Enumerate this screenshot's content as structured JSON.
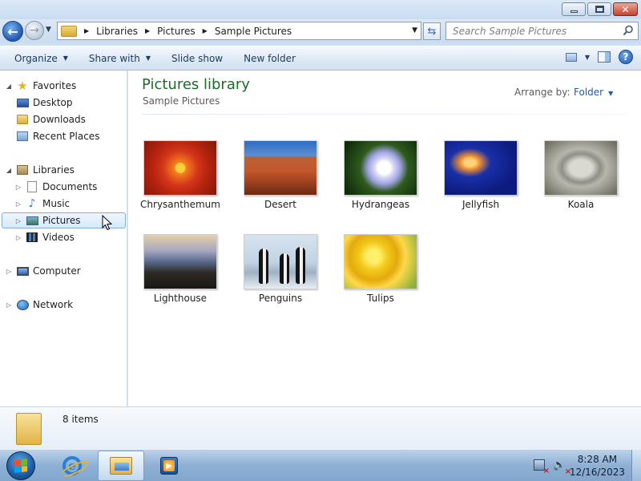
{
  "window": {
    "buttons": {
      "minimize_icon": "minimize-icon",
      "maximize_icon": "maximize-icon",
      "close_icon": "close-icon"
    }
  },
  "address_bar": {
    "breadcrumbs": [
      "Libraries",
      "Pictures",
      "Sample Pictures"
    ],
    "search_placeholder": "Search Sample Pictures"
  },
  "toolbar": {
    "organize": "Organize",
    "share_with": "Share with",
    "slide_show": "Slide show",
    "new_folder": "New folder"
  },
  "nav_pane": {
    "favorites": {
      "label": "Favorites",
      "items": [
        "Desktop",
        "Downloads",
        "Recent Places"
      ]
    },
    "libraries": {
      "label": "Libraries",
      "items": [
        "Documents",
        "Music",
        "Pictures",
        "Videos"
      ],
      "selected": "Pictures"
    },
    "computer": "Computer",
    "network": "Network"
  },
  "content": {
    "title": "Pictures library",
    "subtitle": "Sample Pictures",
    "arrange_label": "Arrange by:",
    "arrange_value": "Folder",
    "files": [
      {
        "name": "Chrysanthemum"
      },
      {
        "name": "Desert"
      },
      {
        "name": "Hydrangeas"
      },
      {
        "name": "Jellyfish"
      },
      {
        "name": "Koala"
      },
      {
        "name": "Lighthouse"
      },
      {
        "name": "Penguins"
      },
      {
        "name": "Tulips"
      }
    ]
  },
  "details": {
    "item_count": "8 items"
  },
  "taskbar": {
    "clock_time": "8:28 AM",
    "clock_date": "12/16/2023"
  },
  "colors": {
    "title_green": "#1e6a2b",
    "link_blue": "#1f5bab",
    "selection_border": "#84acdd"
  }
}
